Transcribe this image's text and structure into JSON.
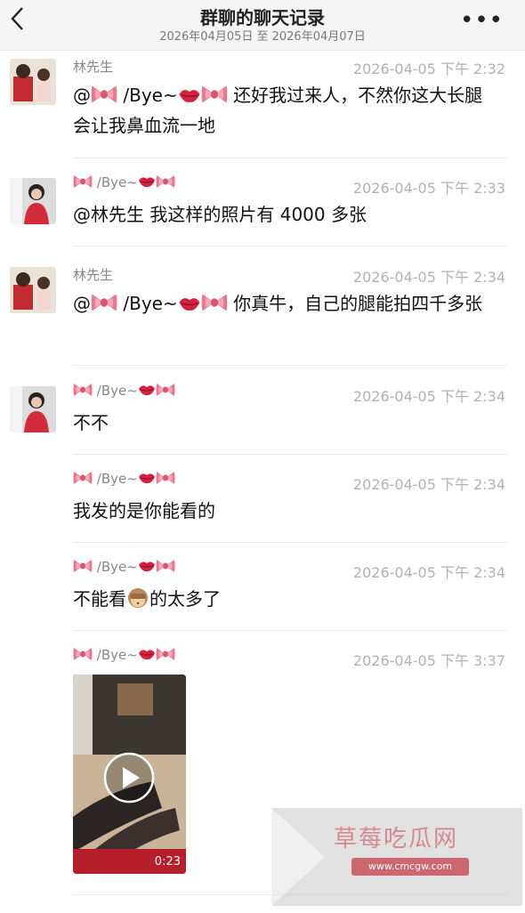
{
  "header": {
    "title": "群聊的聊天记录",
    "date_range": "2026年04月05日 至 2026年04月07日"
  },
  "messages": [
    {
      "sender": "林先生",
      "time": "2026-04-05 下午 2:32",
      "text_prefix": "@",
      "text_suffix": " 还好我过来人，不然你这大长腿会让我鼻血流一地",
      "mention_name": "/Bye~"
    },
    {
      "sender": "/Bye~",
      "time": "2026-04-05 下午 2:33",
      "text": "@林先生 我这样的照片有 4000 多张"
    },
    {
      "sender": "林先生",
      "time": "2026-04-05 下午 2:34",
      "text_prefix": "@",
      "text_suffix": " 你真牛，自己的腿能拍四千多张",
      "mention_name": "/Bye~"
    },
    {
      "sender": "/Bye~",
      "time": "2026-04-05 下午 2:34",
      "text": "不不"
    },
    {
      "sender": "/Bye~",
      "time": "2026-04-05 下午 2:34",
      "text": "我发的是你能看的"
    },
    {
      "sender": "/Bye~",
      "time": "2026-04-05 下午 2:34",
      "text_prefix": "不能看",
      "text_suffix": "的太多了"
    },
    {
      "sender": "/Bye~",
      "time": "2026-04-05 下午 3:37",
      "video_duration": "0:23"
    }
  ],
  "watermark": {
    "title": "草莓吃瓜网",
    "url": "www.cmcgw.com"
  },
  "icons": {
    "back": "chevron-left-icon",
    "more": "more-dots-icon",
    "bow": "pink-bow-icon",
    "lips": "red-lips-icon",
    "monkey": "see-no-evil-monkey-icon",
    "play": "play-icon"
  },
  "colors": {
    "time_gray": "#b2b2b2",
    "name_gray": "#888888",
    "bow_pink": "#e56b84",
    "lips_red": "#d4213d"
  }
}
